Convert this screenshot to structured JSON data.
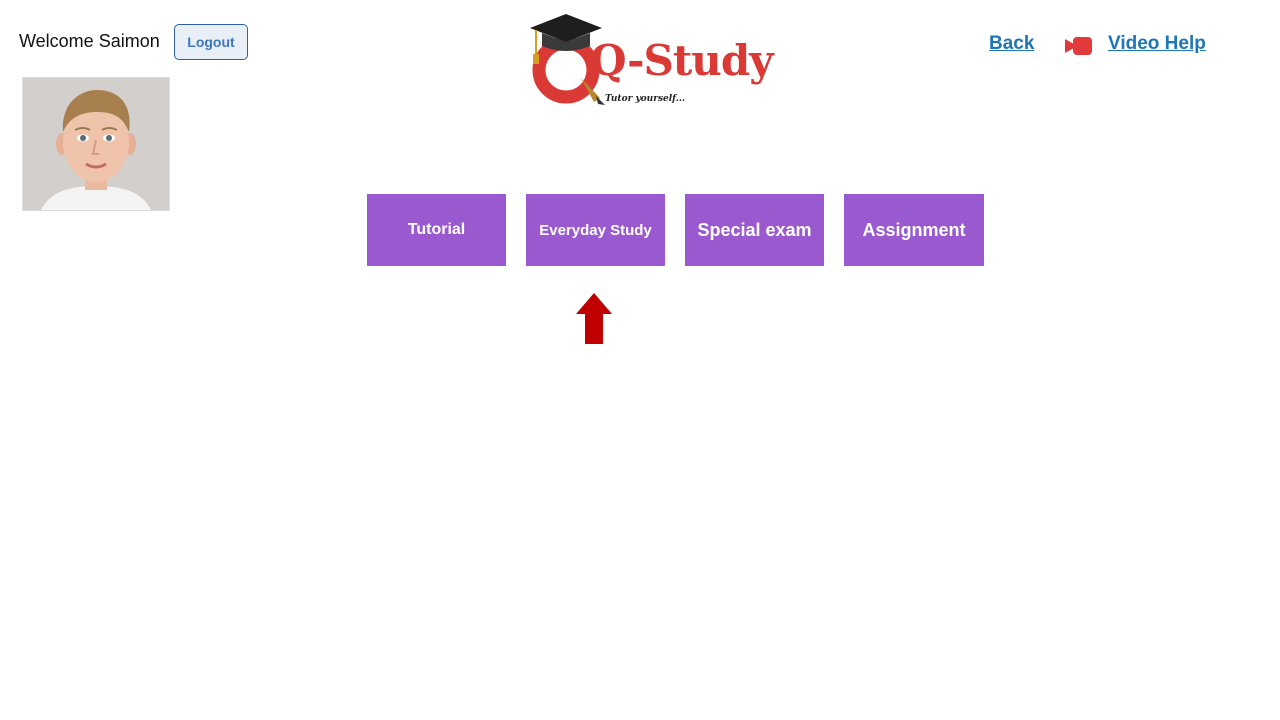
{
  "header": {
    "welcome_text": "Welcome Saimon",
    "logout_label": "Logout"
  },
  "logo": {
    "text": "Q-Study",
    "tagline": "Tutor yourself..."
  },
  "nav": {
    "back_label": "Back",
    "video_help_label": "Video Help"
  },
  "menu": {
    "items": [
      {
        "label": "Tutorial"
      },
      {
        "label": "Everyday Study"
      },
      {
        "label": "Special exam"
      },
      {
        "label": "Assignment"
      }
    ],
    "highlighted": "Everyday Study"
  },
  "icons": {
    "profile": "avatar-photo",
    "video": "video-camera-icon",
    "pointer": "up-arrow-icon"
  },
  "colors": {
    "menu_button": "#9b59cf",
    "link": "#1f76b4",
    "logo_red": "#d93a35",
    "arrow": "#c00000"
  }
}
